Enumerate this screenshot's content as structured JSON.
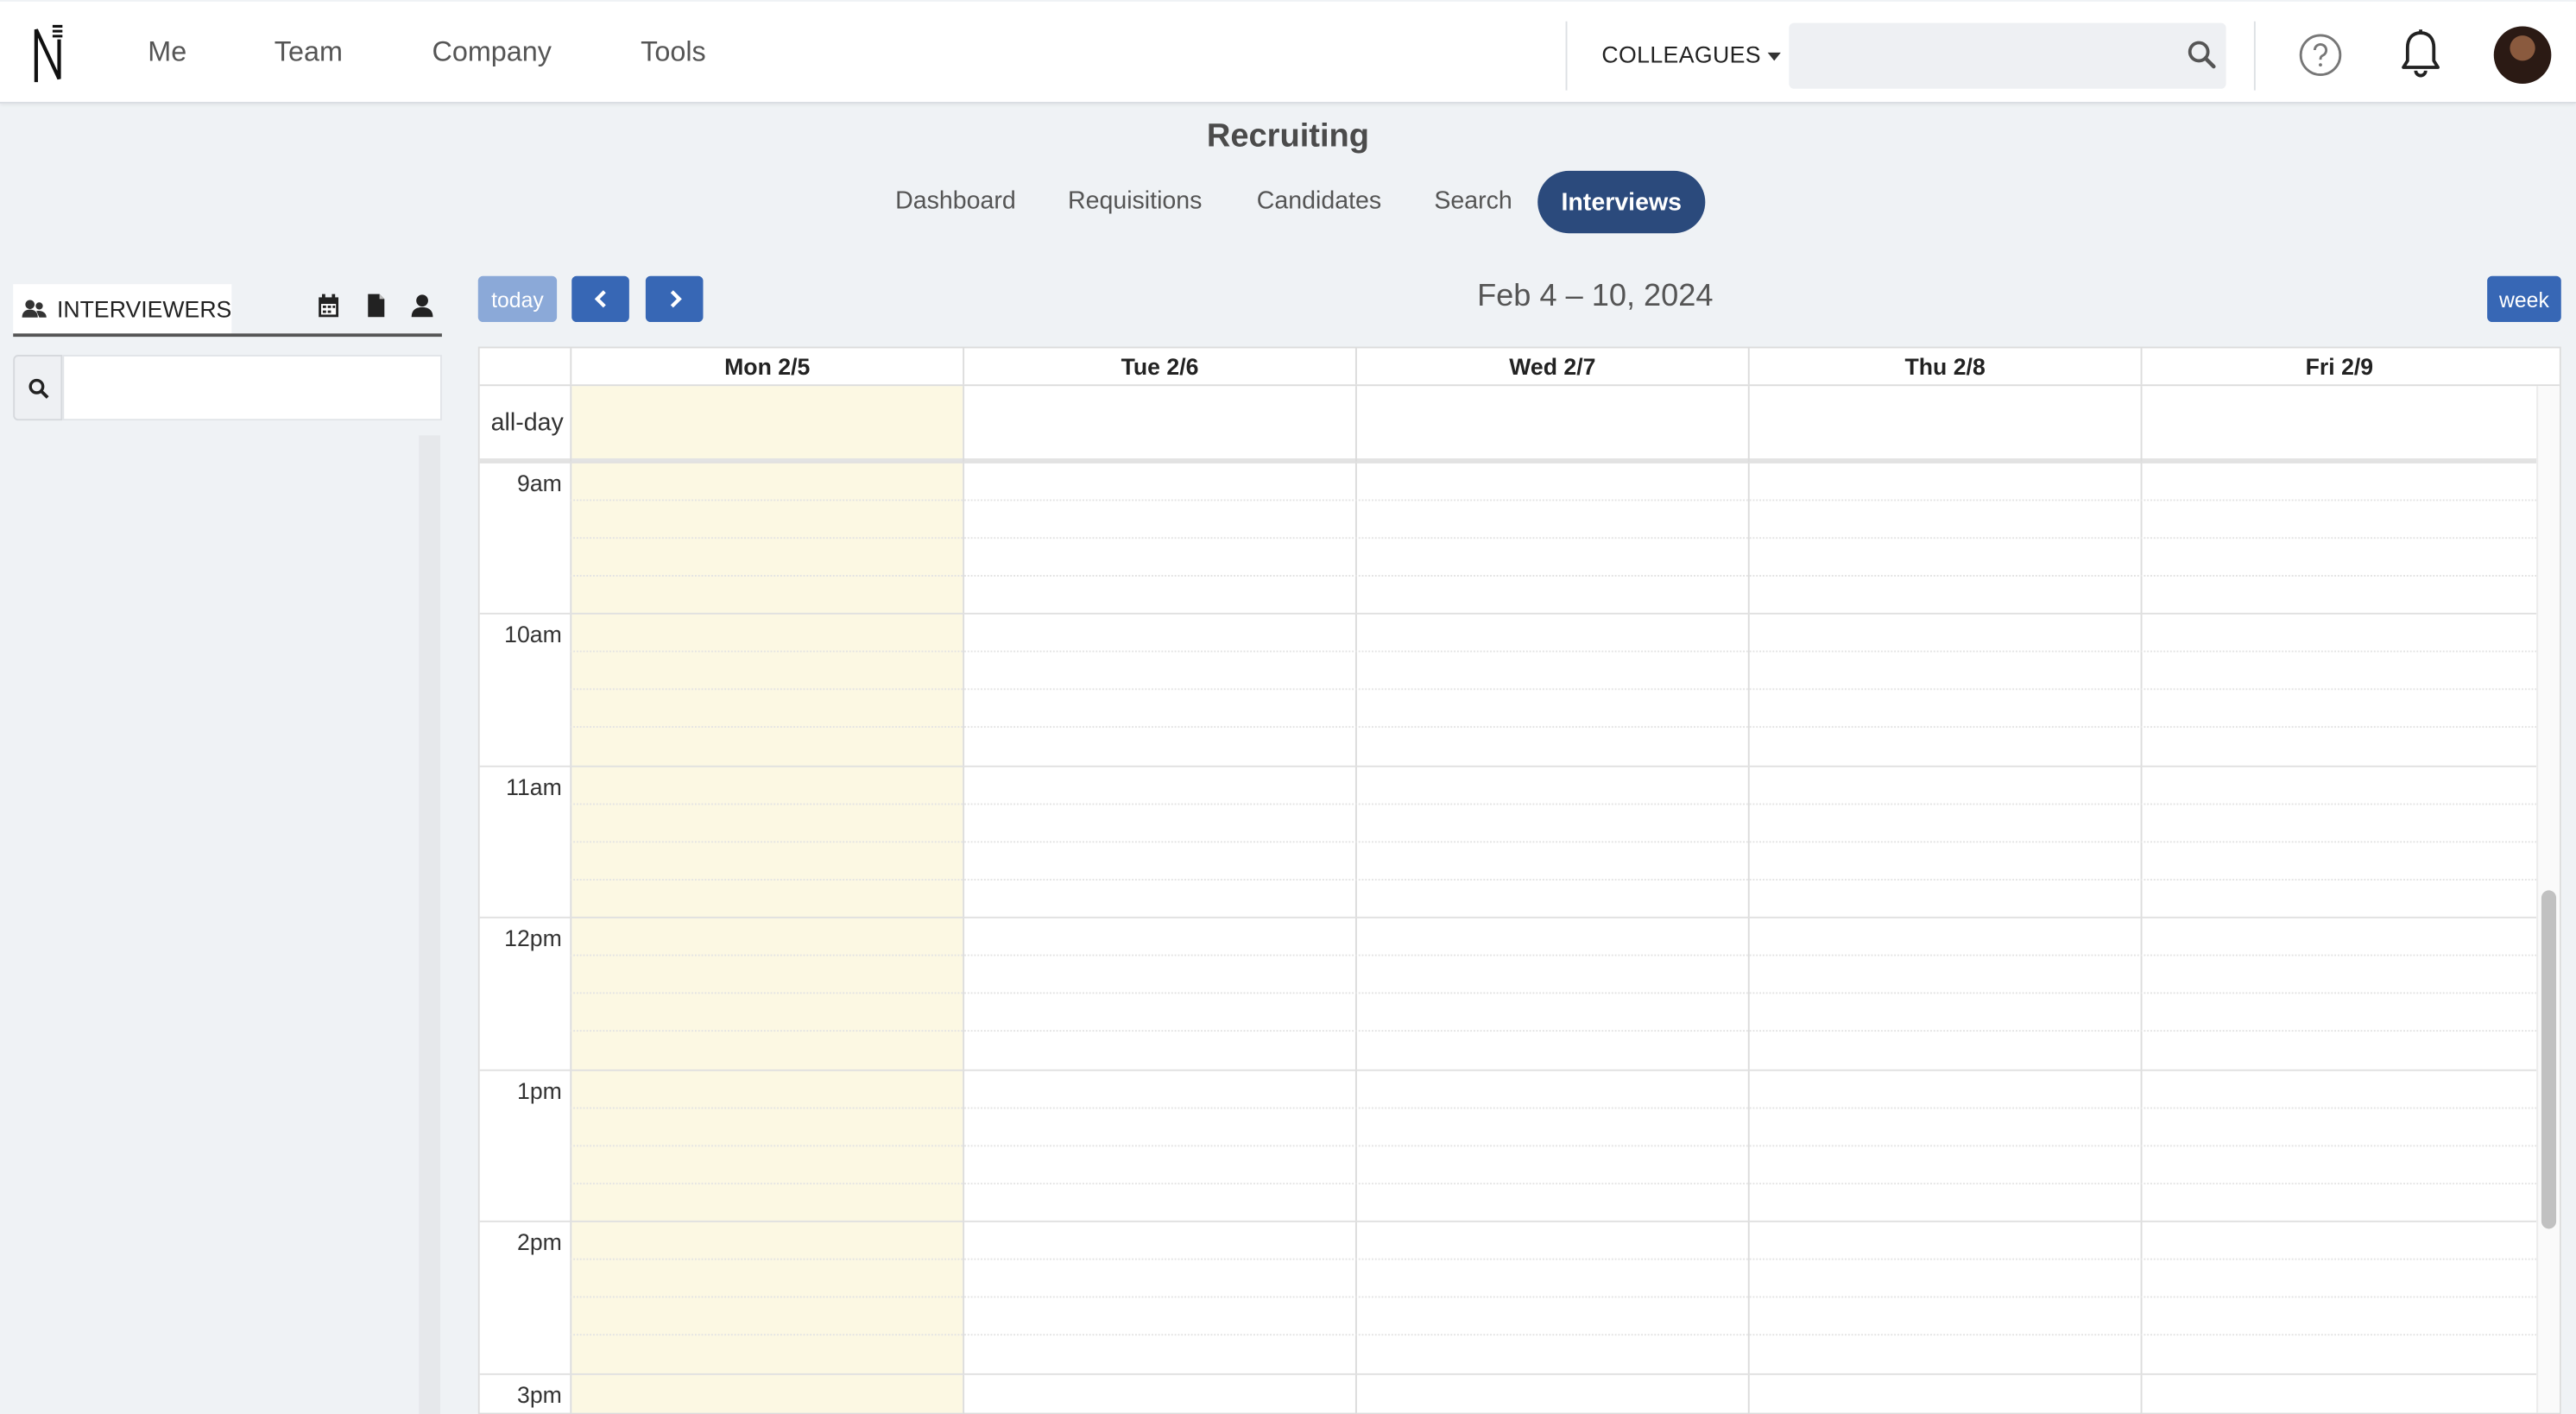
{
  "nav": {
    "items": [
      "Me",
      "Team",
      "Company",
      "Tools"
    ],
    "colleagues_label": "COLLEAGUES",
    "search_placeholder": ""
  },
  "recruiting": {
    "title": "Recruiting",
    "tabs": [
      "Dashboard",
      "Requisitions",
      "Candidates",
      "Search",
      "Interviews"
    ],
    "active_tab": "Interviews"
  },
  "left_panel": {
    "tab_label": "INTERVIEWERS",
    "icons": [
      "calendar-icon",
      "document-icon",
      "user-icon"
    ],
    "search_value": ""
  },
  "calendar": {
    "today_label": "today",
    "range_title": "Feb 4 – 10, 2024",
    "view_label": "week",
    "days": [
      "Mon 2/5",
      "Tue 2/6",
      "Wed 2/7",
      "Thu 2/8",
      "Fri 2/9"
    ],
    "today_day": "Mon 2/5",
    "allday_label": "all-day",
    "times": [
      "9am",
      "10am",
      "11am",
      "12pm",
      "1pm",
      "2pm",
      "3pm"
    ]
  },
  "colors": {
    "accent": "#2b4a7c",
    "button": "#3767b5",
    "today_button": "#8ba9d8",
    "today_highlight": "#fcf8e3"
  }
}
